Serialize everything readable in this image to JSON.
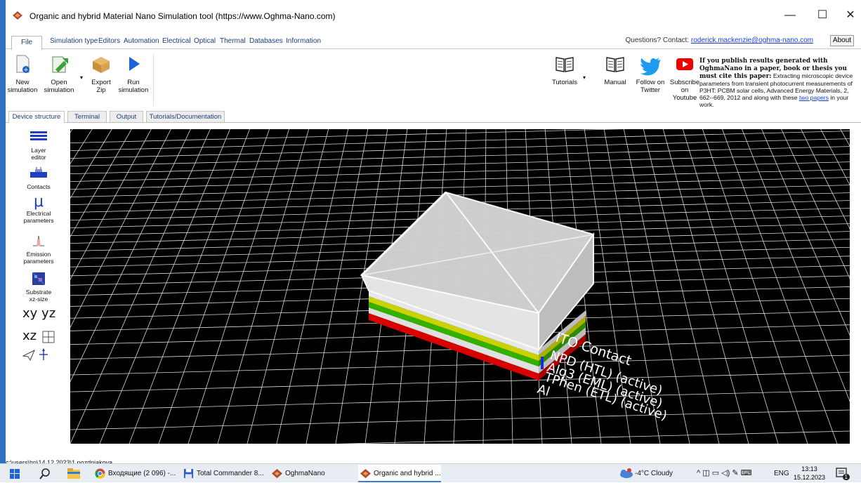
{
  "window": {
    "title": "Organic and hybrid Material Nano Simulation tool (https://www.Oghma-Nano.com)",
    "controls": [
      "—",
      "☐",
      "✕"
    ]
  },
  "menu": {
    "items": [
      "File",
      "Simulation type",
      "Editors",
      "Automation",
      "Electrical",
      "Optical",
      "Thermal",
      "Databases",
      "Information"
    ],
    "contact_prefix": "Questions? Contact:",
    "contact_email": "roderick.mackenzie@oghma-nano.com",
    "about": "About"
  },
  "ribbon": {
    "new_simulation": "New\nsimulation",
    "open_simulation": "Open\nsimulation",
    "export_zip": "Export\nZip",
    "run_simulation": "Run\nsimulation",
    "tutorials": "Tutorials",
    "manual": "Manual",
    "follow_twitter": "Follow on\nTwitter",
    "subscribe_youtube": "Subscribe\non Youtube"
  },
  "citation": {
    "heading": "If you publish results generated with OghmaNano in a paper, book or thesis you must cite this paper:",
    "body": "Extracting microscopic device parameters from transient photocurrent measurements of P3HT: PCBM solar cells, Advanced Energy Materials, 2, 662--669, 2012 and along with these",
    "link": "two papers",
    "tail": "in your work."
  },
  "tabs": [
    "Device structure",
    "Terminal",
    "Output",
    "Tutorials/Documentation"
  ],
  "sidebar": {
    "layer_editor": "Layer\neditor",
    "contacts": "Contacts",
    "electrical": "Electrical\nparameters",
    "emission": "Emission\nparameters",
    "substrate": "Substrate\nxz-size",
    "xy": "xy",
    "yz": "yz",
    "xz": "xz"
  },
  "viewport": {
    "labels": [
      "ITO Contact",
      "NPD (HTL) (active)",
      "Alq3 (EML) (active)",
      "TPhen (ETL) (active)",
      "Al"
    ],
    "layer_colors": [
      "#d8d8d8",
      "#e8e8e8",
      "#c9d300",
      "#34b000",
      "#e0e0e0",
      "#d80000"
    ]
  },
  "status": {
    "path": "c:\\users\\hp\\14.12.2023\\1 pozdniakova"
  },
  "taskbar": {
    "apps": [
      "Входящие (2 096) -...",
      "Total Commander 8...",
      "OghmaNano",
      "Organic and hybrid ..."
    ],
    "weather": "-4°C  Cloudy",
    "lang": "ENG",
    "time": "13:13",
    "date": "15.12.2023",
    "notif_count": "1"
  }
}
